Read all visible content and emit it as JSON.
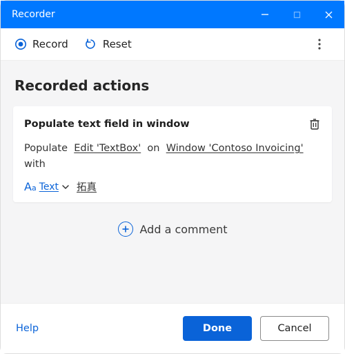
{
  "window": {
    "title": "Recorder"
  },
  "toolbar": {
    "record_label": "Record",
    "reset_label": "Reset"
  },
  "body": {
    "heading": "Recorded actions"
  },
  "action": {
    "title": "Populate text field in window",
    "verb": "Populate",
    "element_ref": "Edit 'TextBox'",
    "on_word": "on",
    "window_ref": "Window 'Contoso Invoicing'",
    "with_word": "with",
    "input_type_label": "Text",
    "value": "拓真"
  },
  "add_comment_label": "Add a comment",
  "footer": {
    "help_label": "Help",
    "done_label": "Done",
    "cancel_label": "Cancel"
  }
}
